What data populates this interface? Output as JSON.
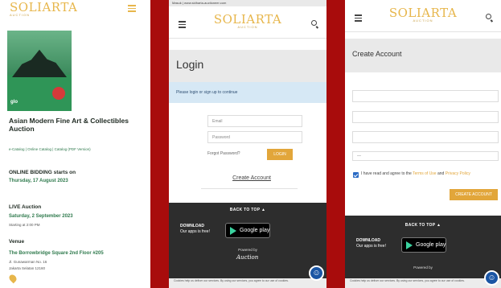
{
  "brand": {
    "logo": "sotheby-like",
    "logo_text": "SOLIARTA",
    "logo_sub": "AUCTION"
  },
  "screen1": {
    "poster_text": "glo",
    "title": "Asian Modern Fine Art & Collectibles Auction",
    "links": "e-Catalog | Online Catalog | Catalog (PDF Version)",
    "online_label": "ONLINE BIDDING starts on",
    "online_date": "Thursday, 17 August 2023",
    "live_label": "LIVE Auction",
    "live_date": "Saturday, 2 September 2023",
    "live_time": "Starting at 2:00 PM",
    "venue_label": "Venue",
    "venue_name": "The Borrowbridge Square 2nd Floor #205",
    "venue_addr1": "Jl. Gunawarman No. 16",
    "venue_addr2": "Jakarta Selatan 12160"
  },
  "screen2": {
    "url": "Masuk | www.sidharta-auctioneer.com",
    "page_title": "Login",
    "notice": "Please login or sign up to continue",
    "email_placeholder": "Email",
    "password_placeholder": "Password",
    "forgot": "Forgot Password?",
    "login_button": "LOGIN",
    "create_account": "Create Account",
    "back_to_top": "BACK TO TOP ▲",
    "download_line1": "DOWNLOAD",
    "download_line2": "Our apps is free!",
    "google_play": "Google play",
    "powered_by": "Powered by",
    "auction_logo": "Auction",
    "cookie_notice": "Cookies help us deliver our services. By using our services, you agree to our use of cookies."
  },
  "screen3": {
    "page_title": "Create Account",
    "dropdown_value": "—",
    "agree_text": "I have read and agree to the",
    "terms_link": "Terms of Use",
    "and": "and",
    "privacy_link": "Privacy Policy",
    "create_button": "CREATE ACCOUNT",
    "back_to_top": "BACK TO TOP ▲",
    "download_line1": "DOWNLOAD",
    "download_line2": "Our apps is free!",
    "google_play": "Google play",
    "powered_by": "Powered by",
    "cookie_notice": "Cookies help us deliver our services. By using our services, you agree to our use of cookies."
  },
  "colors": {
    "background": "#a80c0c",
    "gold": "#e7b64b",
    "button": "#e2a63a",
    "footer": "#2d2d2d",
    "notice": "#d6e8f5"
  }
}
